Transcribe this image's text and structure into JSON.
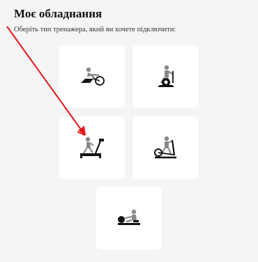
{
  "header": {
    "title": "Моє обладнання",
    "subtitle": "Оберіть тип тренажера, який ви хочете підключити:"
  },
  "equipment": [
    {
      "icon": "bike-icon"
    },
    {
      "icon": "upright-bike-icon"
    },
    {
      "icon": "treadmill-icon"
    },
    {
      "icon": "elliptical-icon"
    },
    {
      "icon": "rower-icon"
    }
  ],
  "annotation": {
    "arrow_color": "#e4161b"
  }
}
